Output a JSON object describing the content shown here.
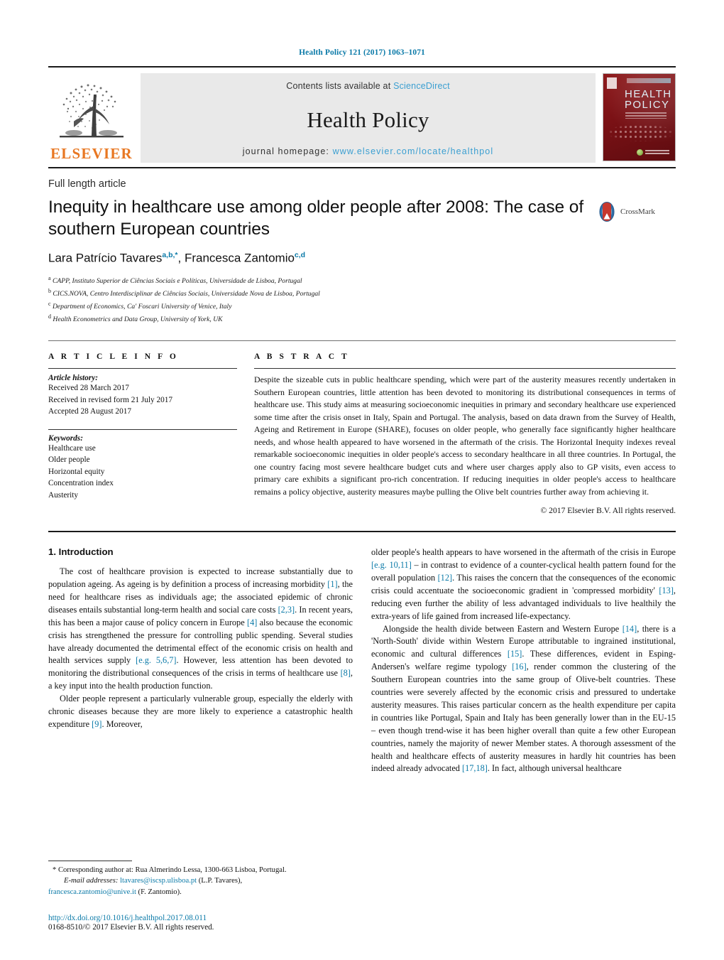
{
  "running_head": "Health Policy 121 (2017) 1063–1071",
  "masthead": {
    "publisher_name": "ELSEVIER",
    "contents_prefix": "Contents lists available at",
    "contents_link": "ScienceDirect",
    "journal_title": "Health Policy",
    "homepage_prefix": "journal homepage:",
    "homepage_url": "www.elsevier.com/locate/healthpol",
    "cover_title_line1": "HEALTH",
    "cover_title_line2": "POLICY",
    "link_color": "#3b9fd1",
    "accent_color": "#0b7aa8",
    "elsevier_orange": "#E87722"
  },
  "article": {
    "type": "Full length article",
    "title": "Inequity in healthcare use among older people after 2008: The case of southern European countries",
    "crossmark_label": "CrossMark",
    "authors_html": "Lara Patrício Tavares",
    "author1": "Lara Patrício Tavares",
    "author1_marks": "a,b,*",
    "author2": "Francesca Zantomio",
    "author2_marks": "c,d",
    "affiliations": [
      {
        "mark": "a",
        "text": "CAPP, Instituto Superior de Ciências Sociais e Políticas, Universidade de Lisboa, Portugal"
      },
      {
        "mark": "b",
        "text": "CICS.NOVA, Centro Interdisciplinar de Ciências Sociais, Universidade Nova de Lisboa, Portugal"
      },
      {
        "mark": "c",
        "text": "Department of Economics, Ca' Foscari University of Venice, Italy"
      },
      {
        "mark": "d",
        "text": "Health Econometrics and Data Group, University of York, UK"
      }
    ]
  },
  "info": {
    "heading": "A R T I C L E   I N F O",
    "history_label": "Article history:",
    "history": [
      "Received 28 March 2017",
      "Received in revised form 21 July 2017",
      "Accepted 28 August 2017"
    ],
    "keywords_label": "Keywords:",
    "keywords": [
      "Healthcare use",
      "Older people",
      "Horizontal equity",
      "Concentration index",
      "Austerity"
    ]
  },
  "abstract": {
    "heading": "A B S T R A C T",
    "text": "Despite the sizeable cuts in public healthcare spending, which were part of the austerity measures recently undertaken in Southern European countries, little attention has been devoted to monitoring its distributional consequences in terms of healthcare use. This study aims at measuring socioeconomic inequities in primary and secondary healthcare use experienced some time after the crisis onset in Italy, Spain and Portugal. The analysis, based on data drawn from the Survey of Health, Ageing and Retirement in Europe (SHARE), focuses on older people, who generally face significantly higher healthcare needs, and whose health appeared to have worsened in the aftermath of the crisis. The Horizontal Inequity indexes reveal remarkable socioeconomic inequities in older people's access to secondary healthcare in all three countries. In Portugal, the one country facing most severe healthcare budget cuts and where user charges apply also to GP visits, even access to primary care exhibits a significant pro-rich concentration. If reducing inequities in older people's access to healthcare remains a policy objective, austerity measures maybe pulling the Olive belt countries further away from achieving it.",
    "copyright": "© 2017 Elsevier B.V. All rights reserved."
  },
  "body": {
    "section_number_title": "1.  Introduction",
    "left_paragraphs": [
      "The cost of healthcare provision is expected to increase substantially due to population ageing. As ageing is by definition a process of increasing morbidity [1], the need for healthcare rises as individuals age; the associated epidemic of chronic diseases entails substantial long-term health and social care costs [2,3]. In recent years, this has been a major cause of policy concern in Europe [4] also because the economic crisis has strengthened the pressure for controlling public spending. Several studies have already documented the detrimental effect of the economic crisis on health and health services supply [e.g. 5,6,7]. However, less attention has been devoted to monitoring the distributional consequences of the crisis in terms of healthcare use [8], a key input into the health production function.",
      "Older people represent a particularly vulnerable group, especially the elderly with chronic diseases because they are more likely to experience a catastrophic health expenditure [9]. Moreover,"
    ],
    "right_paragraphs": [
      "older people's health appears to have worsened in the aftermath of the crisis in Europe [e.g. 10,11] – in contrast to evidence of a counter-cyclical health pattern found for the overall population [12]. This raises the concern that the consequences of the economic crisis could accentuate the socioeconomic gradient in 'compressed morbidity' [13], reducing even further the ability of less advantaged individuals to live healthily the extra-years of life gained from increased life-expectancy.",
      "Alongside the health divide between Eastern and Western Europe [14], there is a 'North-South' divide within Western Europe attributable to ingrained institutional, economic and cultural differences [15]. These differences, evident in Esping-Andersen's welfare regime typology [16], render common the clustering of the Southern European countries into the same group of Olive-belt countries. These countries were severely affected by the economic crisis and pressured to undertake austerity measures. This raises particular concern as the health expenditure per capita in countries like Portugal, Spain and Italy has been generally lower than in the EU-15 – even though trend-wise it has been higher overall than quite a few other European countries, namely the majority of newer Member states. A thorough assessment of the health and healthcare effects of austerity measures in hardly hit countries has been indeed already advocated [17,18]. In fact, although universal healthcare"
    ]
  },
  "footnotes": {
    "corresponding": "* Corresponding author at: Rua Almerindo Lessa, 1300-663 Lisboa, Portugal.",
    "email_label": "E-mail addresses:",
    "email1": "ltavares@iscsp.ulisboa.pt",
    "email1_owner": "(L.P. Tavares),",
    "email2": "francesca.zantomio@unive.it",
    "email2_owner": "(F. Zantomio).",
    "doi": "http://dx.doi.org/10.1016/j.healthpol.2017.08.011",
    "issn_line": "0168-8510/© 2017 Elsevier B.V. All rights reserved."
  }
}
